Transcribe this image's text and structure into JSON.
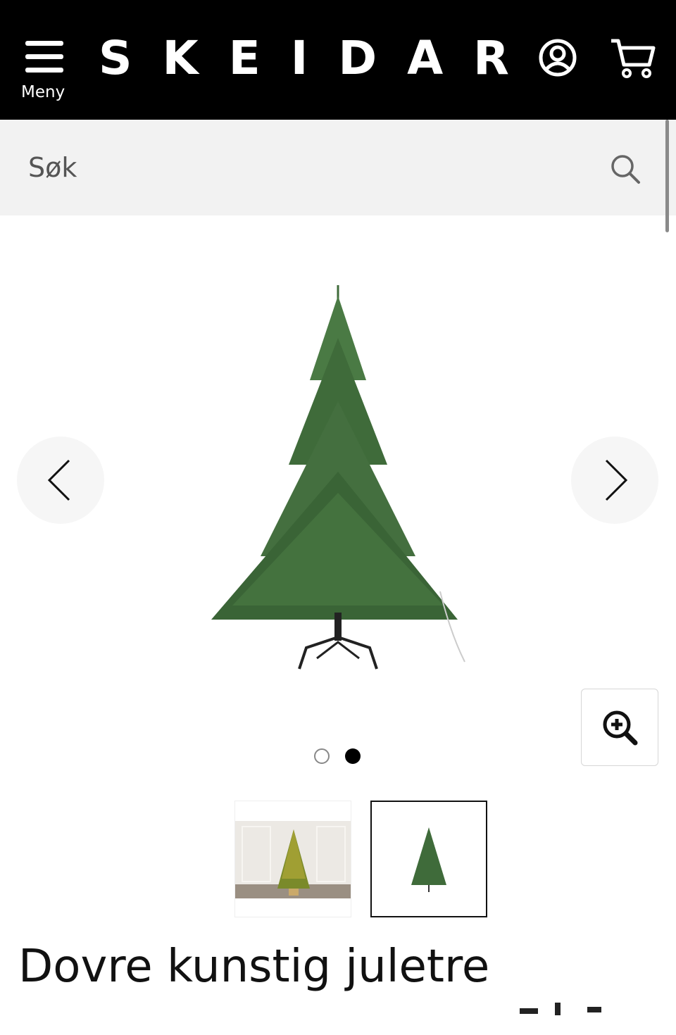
{
  "header": {
    "menu_label": "Meny",
    "logo": "SKEIDAR",
    "account_icon": "user-circle-icon",
    "cart_icon": "cart-icon"
  },
  "search": {
    "placeholder": "Søk",
    "icon": "search-icon"
  },
  "gallery": {
    "main_image": "christmas-tree-with-stand",
    "prev_icon": "chevron-left-icon",
    "next_icon": "chevron-right-icon",
    "zoom_icon": "zoom-in-icon",
    "slide_count": 2,
    "active_slide": 2,
    "thumbnails": [
      {
        "image": "lit-christmas-tree-in-room",
        "selected": false
      },
      {
        "image": "christmas-tree-on-white",
        "selected": true
      }
    ]
  },
  "product": {
    "title": "Dovre kunstig juletre"
  },
  "colors": {
    "header_bg": "#000000",
    "search_bg": "#f2f2f2",
    "tree_green": "#3f6b3a"
  }
}
